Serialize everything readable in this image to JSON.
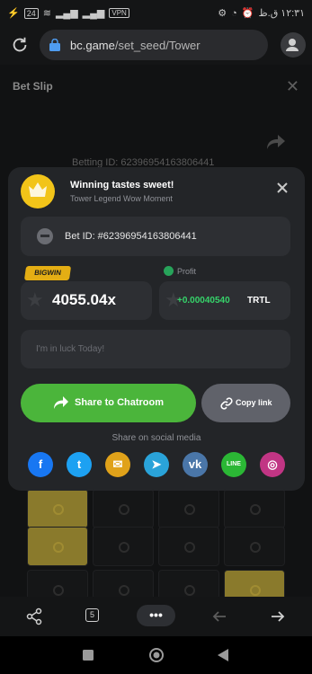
{
  "status_bar": {
    "time": "١٢:٣١ ق.ظ",
    "battery": "24",
    "vpn": "VPN"
  },
  "browser": {
    "url_host": "bc.game",
    "url_path": "/set_seed/Tower",
    "tab_count": "5",
    "more_label": "•••"
  },
  "background": {
    "bet_slip": "Bet Slip",
    "betting_id": "Betting ID: 62396954163806441"
  },
  "modal": {
    "title": "Winning tastes sweet!",
    "subtitle": "Tower Legend Wow Moment",
    "bet_id": "Bet ID: #62396954163806441",
    "bigwin_badge": "BIGWIN",
    "profit_label": "Profit",
    "multiplier": "4055.04x",
    "profit_value": "+0.00040540",
    "profit_currency": "TRTL",
    "message_placeholder": "I'm in luck Today!",
    "share_label": "Share to Chatroom",
    "copy_label": "Copy link",
    "social_label": "Share on social media",
    "social_icons": [
      {
        "name": "facebook-icon",
        "color": "#1877f2",
        "glyph": "f"
      },
      {
        "name": "twitter-icon",
        "color": "#1da1f2",
        "glyph": "t"
      },
      {
        "name": "email-icon",
        "color": "#e0a21a",
        "glyph": "✉"
      },
      {
        "name": "telegram-icon",
        "color": "#2aa3d9",
        "glyph": "➤"
      },
      {
        "name": "vk-icon",
        "color": "#4a76a8",
        "glyph": "vk"
      },
      {
        "name": "line-icon",
        "color": "#2bb735",
        "glyph": "LINE"
      },
      {
        "name": "instagram-icon",
        "color": "#c13584",
        "glyph": "◎"
      }
    ]
  },
  "colors": {
    "accent_green": "#4bb53b",
    "profit_green": "#36d36a",
    "gold": "#e4ae14"
  }
}
